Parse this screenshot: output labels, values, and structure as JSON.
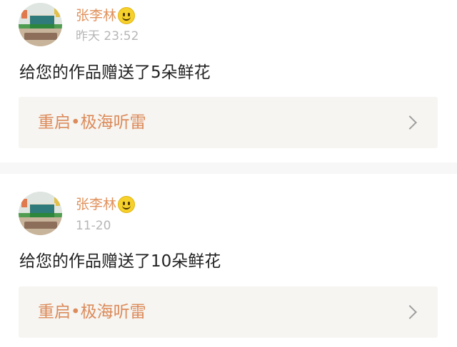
{
  "notifications": [
    {
      "user_name": "张李林",
      "emoji_icon": "smiley-face-icon",
      "time": "昨天 23:52",
      "message": "给您的作品赠送了5朵鲜花",
      "link_title": "重启•极海听雷"
    },
    {
      "user_name": "张李林",
      "emoji_icon": "smiley-face-icon",
      "time": "11-20",
      "message": "给您的作品赠送了10朵鲜花",
      "link_title": "重启•极海听雷"
    }
  ],
  "colors": {
    "accent_orange": "#e0925c",
    "time_gray": "#b6b6b6",
    "text_dark": "#222222",
    "card_bg": "#f6f5f2",
    "separator": "#f7f7f7"
  }
}
